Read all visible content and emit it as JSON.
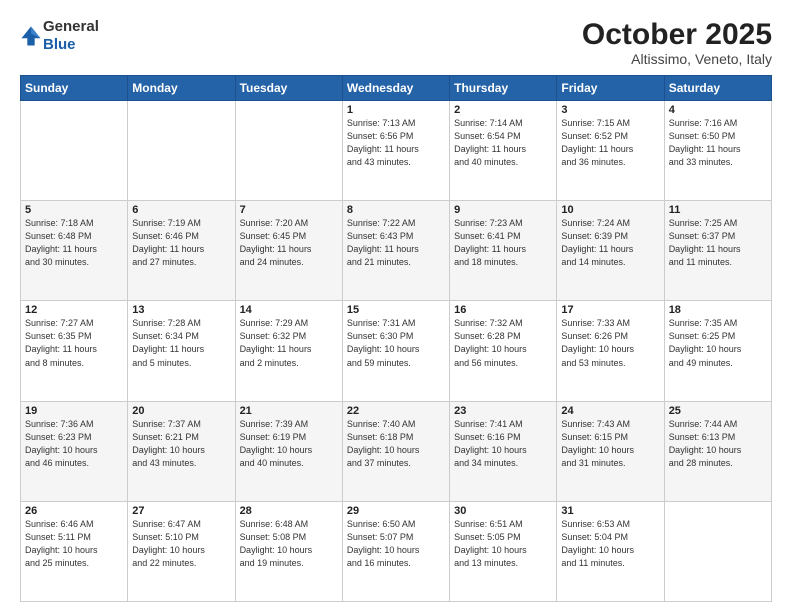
{
  "header": {
    "logo_general": "General",
    "logo_blue": "Blue",
    "month": "October 2025",
    "location": "Altissimo, Veneto, Italy"
  },
  "weekdays": [
    "Sunday",
    "Monday",
    "Tuesday",
    "Wednesday",
    "Thursday",
    "Friday",
    "Saturday"
  ],
  "rows": [
    [
      {
        "day": "",
        "info": ""
      },
      {
        "day": "",
        "info": ""
      },
      {
        "day": "",
        "info": ""
      },
      {
        "day": "1",
        "info": "Sunrise: 7:13 AM\nSunset: 6:56 PM\nDaylight: 11 hours\nand 43 minutes."
      },
      {
        "day": "2",
        "info": "Sunrise: 7:14 AM\nSunset: 6:54 PM\nDaylight: 11 hours\nand 40 minutes."
      },
      {
        "day": "3",
        "info": "Sunrise: 7:15 AM\nSunset: 6:52 PM\nDaylight: 11 hours\nand 36 minutes."
      },
      {
        "day": "4",
        "info": "Sunrise: 7:16 AM\nSunset: 6:50 PM\nDaylight: 11 hours\nand 33 minutes."
      }
    ],
    [
      {
        "day": "5",
        "info": "Sunrise: 7:18 AM\nSunset: 6:48 PM\nDaylight: 11 hours\nand 30 minutes."
      },
      {
        "day": "6",
        "info": "Sunrise: 7:19 AM\nSunset: 6:46 PM\nDaylight: 11 hours\nand 27 minutes."
      },
      {
        "day": "7",
        "info": "Sunrise: 7:20 AM\nSunset: 6:45 PM\nDaylight: 11 hours\nand 24 minutes."
      },
      {
        "day": "8",
        "info": "Sunrise: 7:22 AM\nSunset: 6:43 PM\nDaylight: 11 hours\nand 21 minutes."
      },
      {
        "day": "9",
        "info": "Sunrise: 7:23 AM\nSunset: 6:41 PM\nDaylight: 11 hours\nand 18 minutes."
      },
      {
        "day": "10",
        "info": "Sunrise: 7:24 AM\nSunset: 6:39 PM\nDaylight: 11 hours\nand 14 minutes."
      },
      {
        "day": "11",
        "info": "Sunrise: 7:25 AM\nSunset: 6:37 PM\nDaylight: 11 hours\nand 11 minutes."
      }
    ],
    [
      {
        "day": "12",
        "info": "Sunrise: 7:27 AM\nSunset: 6:35 PM\nDaylight: 11 hours\nand 8 minutes."
      },
      {
        "day": "13",
        "info": "Sunrise: 7:28 AM\nSunset: 6:34 PM\nDaylight: 11 hours\nand 5 minutes."
      },
      {
        "day": "14",
        "info": "Sunrise: 7:29 AM\nSunset: 6:32 PM\nDaylight: 11 hours\nand 2 minutes."
      },
      {
        "day": "15",
        "info": "Sunrise: 7:31 AM\nSunset: 6:30 PM\nDaylight: 10 hours\nand 59 minutes."
      },
      {
        "day": "16",
        "info": "Sunrise: 7:32 AM\nSunset: 6:28 PM\nDaylight: 10 hours\nand 56 minutes."
      },
      {
        "day": "17",
        "info": "Sunrise: 7:33 AM\nSunset: 6:26 PM\nDaylight: 10 hours\nand 53 minutes."
      },
      {
        "day": "18",
        "info": "Sunrise: 7:35 AM\nSunset: 6:25 PM\nDaylight: 10 hours\nand 49 minutes."
      }
    ],
    [
      {
        "day": "19",
        "info": "Sunrise: 7:36 AM\nSunset: 6:23 PM\nDaylight: 10 hours\nand 46 minutes."
      },
      {
        "day": "20",
        "info": "Sunrise: 7:37 AM\nSunset: 6:21 PM\nDaylight: 10 hours\nand 43 minutes."
      },
      {
        "day": "21",
        "info": "Sunrise: 7:39 AM\nSunset: 6:19 PM\nDaylight: 10 hours\nand 40 minutes."
      },
      {
        "day": "22",
        "info": "Sunrise: 7:40 AM\nSunset: 6:18 PM\nDaylight: 10 hours\nand 37 minutes."
      },
      {
        "day": "23",
        "info": "Sunrise: 7:41 AM\nSunset: 6:16 PM\nDaylight: 10 hours\nand 34 minutes."
      },
      {
        "day": "24",
        "info": "Sunrise: 7:43 AM\nSunset: 6:15 PM\nDaylight: 10 hours\nand 31 minutes."
      },
      {
        "day": "25",
        "info": "Sunrise: 7:44 AM\nSunset: 6:13 PM\nDaylight: 10 hours\nand 28 minutes."
      }
    ],
    [
      {
        "day": "26",
        "info": "Sunrise: 6:46 AM\nSunset: 5:11 PM\nDaylight: 10 hours\nand 25 minutes."
      },
      {
        "day": "27",
        "info": "Sunrise: 6:47 AM\nSunset: 5:10 PM\nDaylight: 10 hours\nand 22 minutes."
      },
      {
        "day": "28",
        "info": "Sunrise: 6:48 AM\nSunset: 5:08 PM\nDaylight: 10 hours\nand 19 minutes."
      },
      {
        "day": "29",
        "info": "Sunrise: 6:50 AM\nSunset: 5:07 PM\nDaylight: 10 hours\nand 16 minutes."
      },
      {
        "day": "30",
        "info": "Sunrise: 6:51 AM\nSunset: 5:05 PM\nDaylight: 10 hours\nand 13 minutes."
      },
      {
        "day": "31",
        "info": "Sunrise: 6:53 AM\nSunset: 5:04 PM\nDaylight: 10 hours\nand 11 minutes."
      },
      {
        "day": "",
        "info": ""
      }
    ]
  ]
}
